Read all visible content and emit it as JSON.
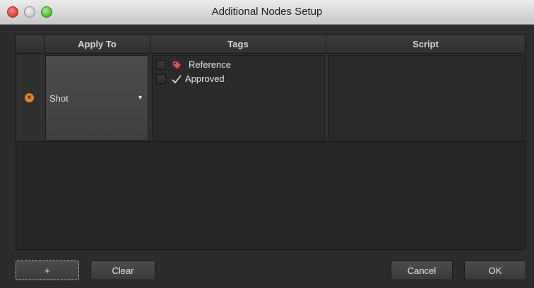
{
  "window": {
    "title": "Additional Nodes Setup"
  },
  "table": {
    "columns": {
      "apply_to": "Apply To",
      "tags": "Tags",
      "script": "Script"
    },
    "rows": [
      {
        "remove_icon": "remove-circle-icon",
        "apply_to": "Shot",
        "tags": [
          {
            "label": "Reference",
            "icon": "tag-icon",
            "checked": false
          },
          {
            "label": "Approved",
            "icon": "checkmark-icon",
            "checked": false
          }
        ],
        "script": ""
      }
    ]
  },
  "buttons": {
    "add": "+",
    "clear": "Clear",
    "cancel": "Cancel",
    "ok": "OK"
  },
  "colors": {
    "remove_icon": "#e8831d",
    "tag_icon": "#d9534f"
  }
}
